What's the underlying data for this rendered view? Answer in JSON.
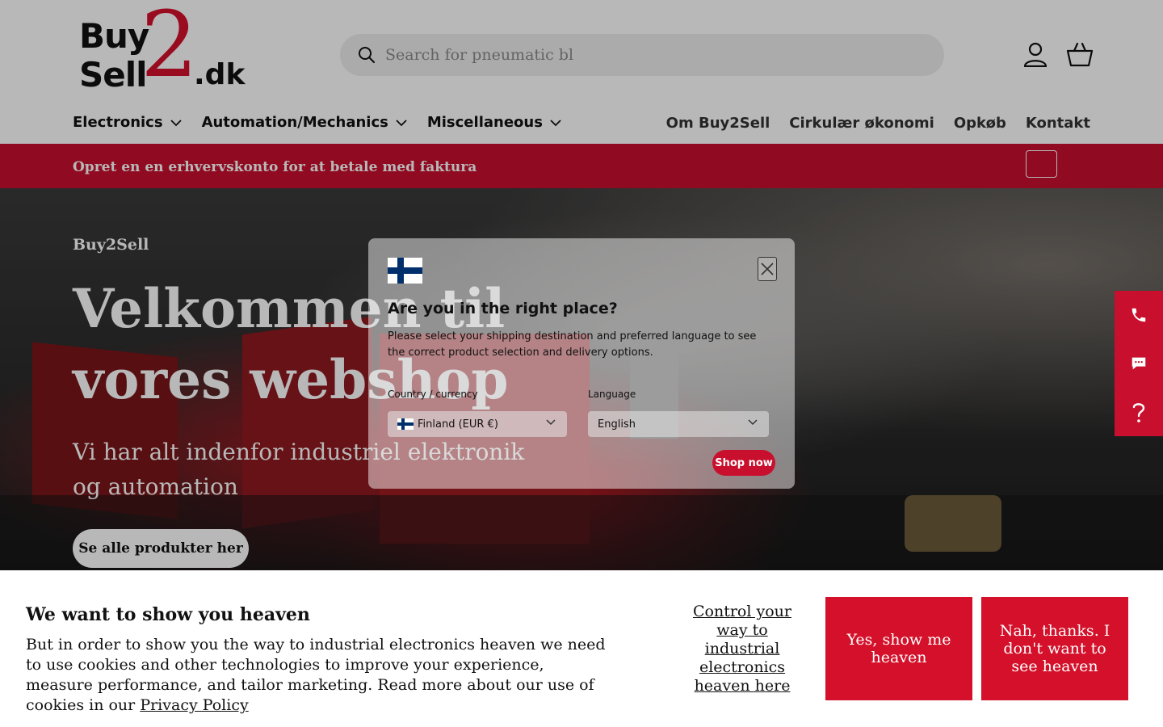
{
  "header": {
    "logo": {
      "line1": "Buy",
      "line2": "Sell",
      "numeral": "2",
      "suffix": ".dk"
    },
    "search_placeholder": "Search for pneumatic bl",
    "account_icon": "user-icon",
    "cart_icon": "basket-icon"
  },
  "nav": {
    "left": [
      {
        "label": "Electronics"
      },
      {
        "label": "Automation/Mechanics"
      },
      {
        "label": "Miscellaneous"
      }
    ],
    "right": [
      {
        "label": "Om Buy2Sell"
      },
      {
        "label": "Cirkulær økonomi"
      },
      {
        "label": "Opkøb"
      },
      {
        "label": "Kontakt"
      }
    ]
  },
  "announcement": {
    "text": "Opret en en erhvervskonto for at betale med faktura"
  },
  "hero": {
    "subheading": "Buy2Sell",
    "title": "Velkommen til vores webshop",
    "description": "Vi har alt indenfor industriel elektronik og automation",
    "button": "Se alle produkter her"
  },
  "side_widgets": [
    "phone-icon",
    "chat-icon",
    "question-icon"
  ],
  "modal": {
    "title": "Are you in the right place?",
    "description": "Please select your shipping destination and preferred language to see the correct product selection and delivery options.",
    "country_label": "Country / currency",
    "country_value": "Finland (EUR €)",
    "language_label": "Language",
    "language_value": "English",
    "shop_button": "Shop now",
    "flag_colors": {
      "blue": "#002f6c",
      "white": "#ffffff"
    }
  },
  "cookie": {
    "title": "We want to show you heaven",
    "text": "But in order to show you the way to industrial electronics heaven we need to use cookies and other technologies to improve your experience, measure performance, and tailor marketing. Read more about our use of cookies in our",
    "link": "Privacy Policy",
    "control_link": "Control your way to industrial electronics heaven here",
    "accept": "Yes, show me heaven",
    "decline": "Nah, thanks. I don't want to see heaven"
  },
  "colors": {
    "brand_red": "#c8102e",
    "cookie_red": "#d4102a"
  }
}
